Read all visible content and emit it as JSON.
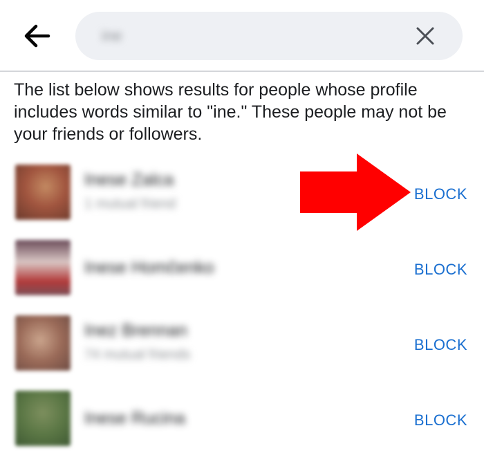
{
  "search": {
    "query": "ine",
    "clear_icon": "close-icon",
    "back_icon": "arrow-left-icon"
  },
  "note": "The list below shows results for people whose profile includes words similar to \"ine.\" These people may not be your friends or followers.",
  "results": [
    {
      "name": "Inese Zalca",
      "mutual": "1 mutual friend",
      "action": "BLOCK",
      "avatar_color": "#9a5a46"
    },
    {
      "name": "Inese Homčenko",
      "mutual": "",
      "action": "BLOCK",
      "avatar_color": "#6d4b55"
    },
    {
      "name": "Inez Brennan",
      "mutual": "74 mutual friends",
      "action": "BLOCK",
      "avatar_color": "#8c6a5a"
    },
    {
      "name": "Inese Rucina",
      "mutual": "",
      "action": "BLOCK",
      "avatar_color": "#5f7a4e"
    }
  ],
  "colors": {
    "link": "#1a6fd0",
    "annotation_arrow": "#ff0000",
    "search_bg": "#eef0f4"
  }
}
